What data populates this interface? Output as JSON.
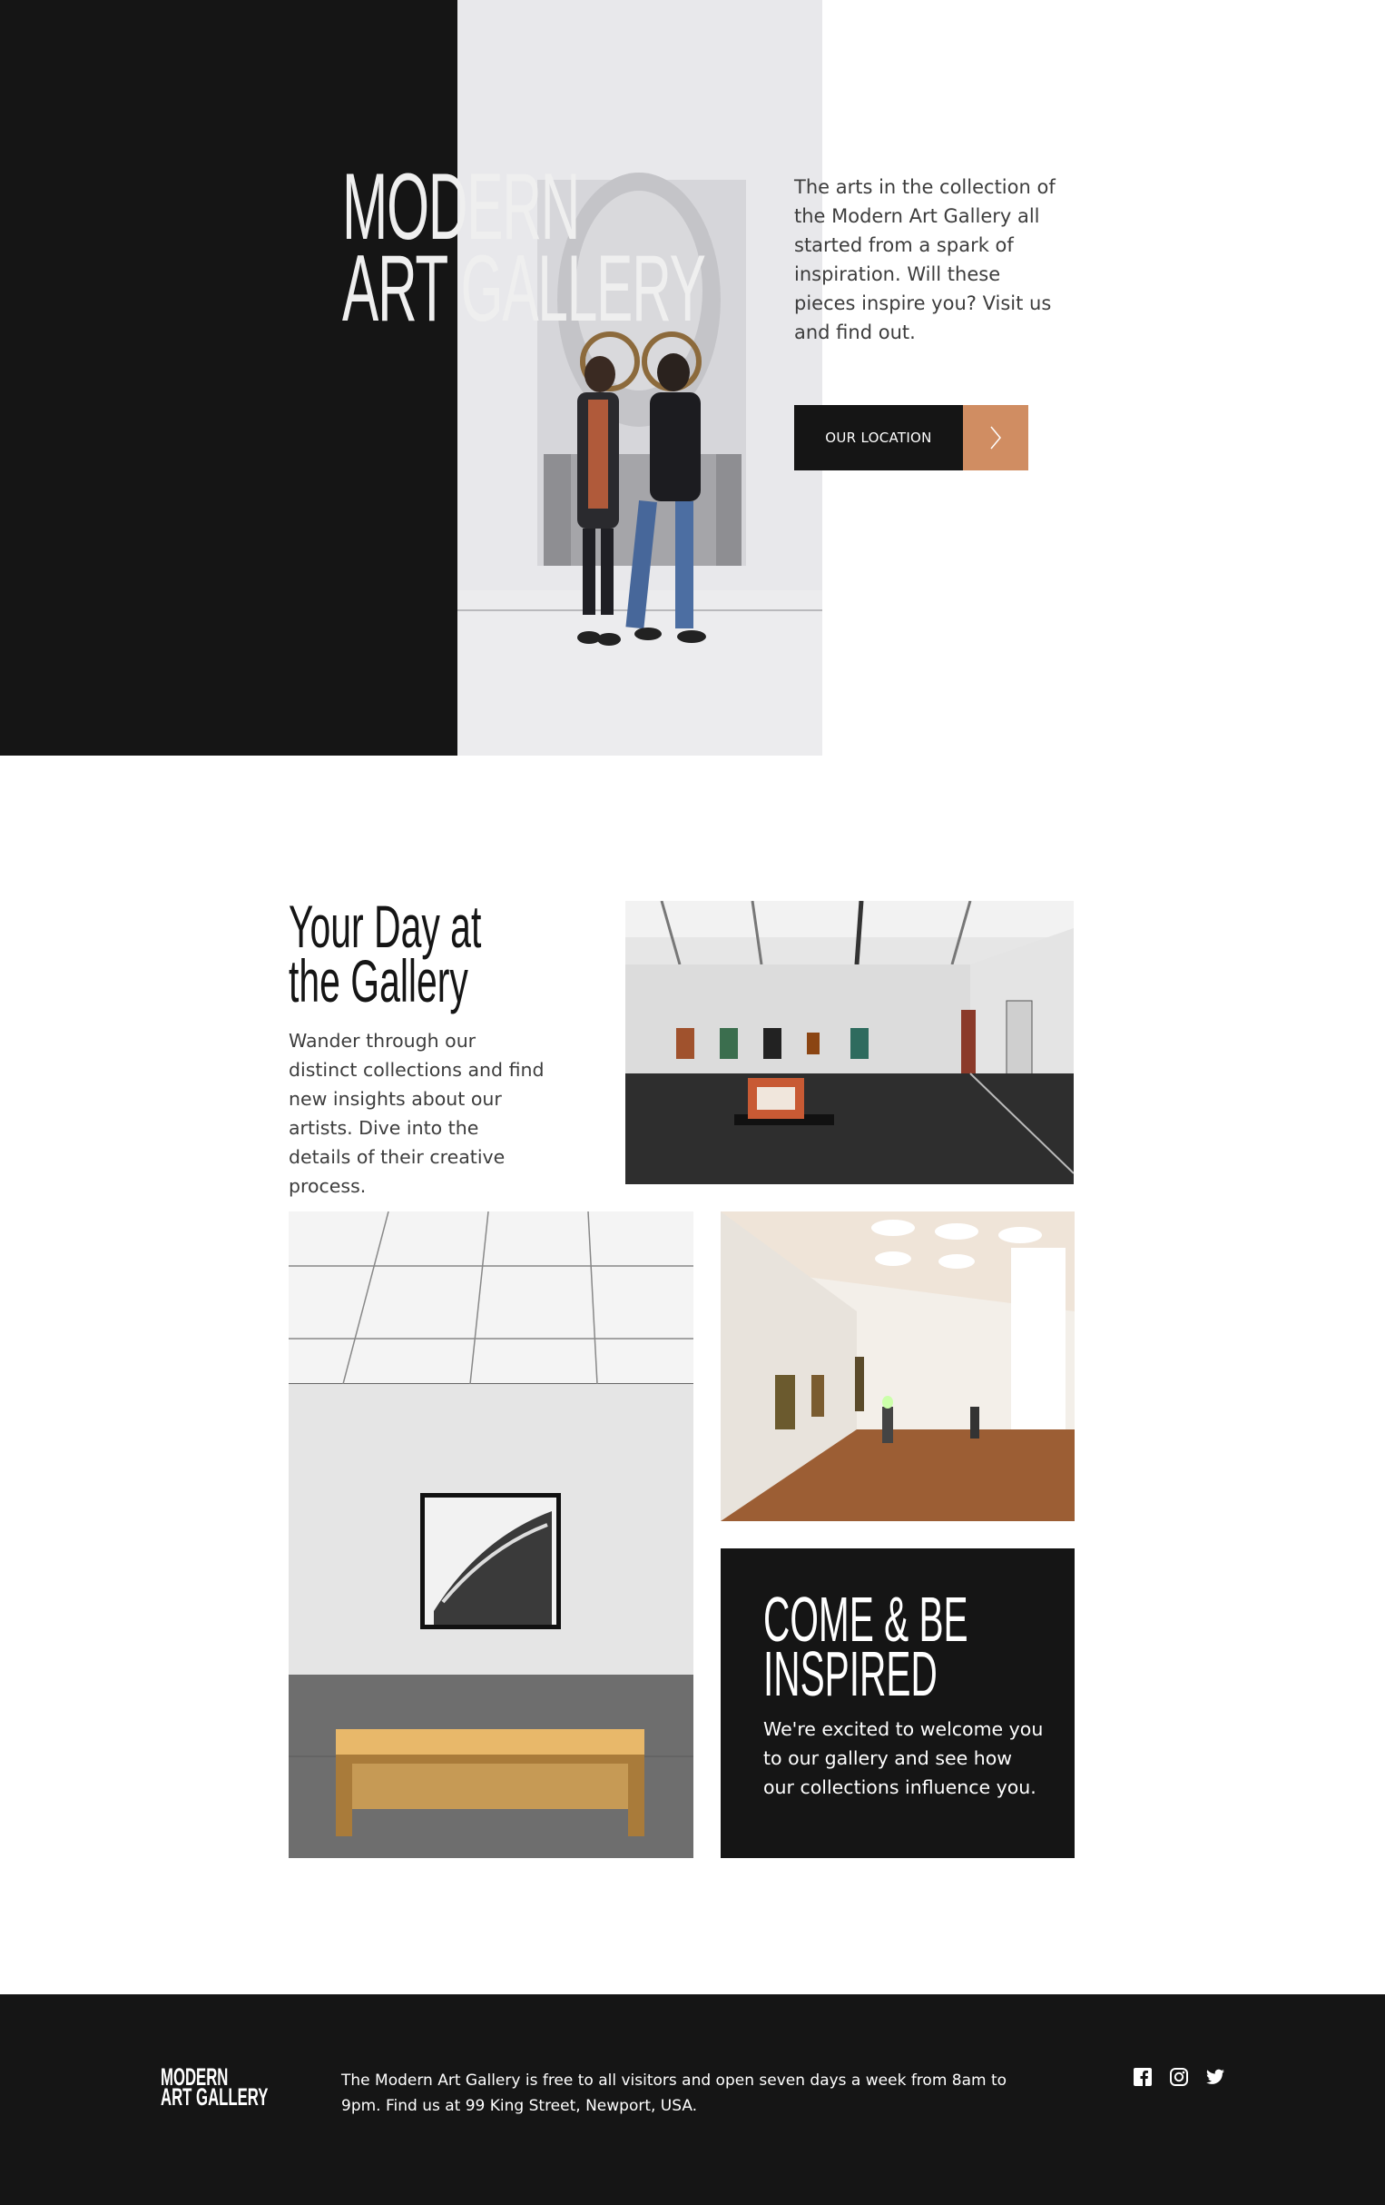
{
  "hero": {
    "title_line1": "MODERN",
    "title_line2": "ART GALLERY",
    "description": "The arts in the collection of the Modern Art Gallery all started from a spark of inspiration. Will these pieces inspire you? Visit us and find out.",
    "button_label": "OUR LOCATION",
    "button_icon": "chevron-right-icon"
  },
  "day_section": {
    "title_line1": "Your Day at",
    "title_line2": "the Gallery",
    "description": "Wander through our distinct collections and find new insights about our artists. Dive into the details of their creative process."
  },
  "inspire_section": {
    "title_line1": "COME & BE",
    "title_line2": "INSPIRED",
    "description": "We're excited to welcome you to our gallery and see how our collections influence you."
  },
  "footer": {
    "logo_line1": "MODERN",
    "logo_line2": "ART GALLERY",
    "info": "The Modern Art Gallery is free to all visitors and open seven days a week from 8am to 9pm. Find us at 99 King Street, Newport, USA.",
    "social_icons": [
      "facebook-icon",
      "instagram-icon",
      "twitter-icon"
    ]
  },
  "colors": {
    "dark": "#151515",
    "accent": "#d08d62",
    "light_text": "#efefef",
    "body_text": "#3d3d3d"
  }
}
